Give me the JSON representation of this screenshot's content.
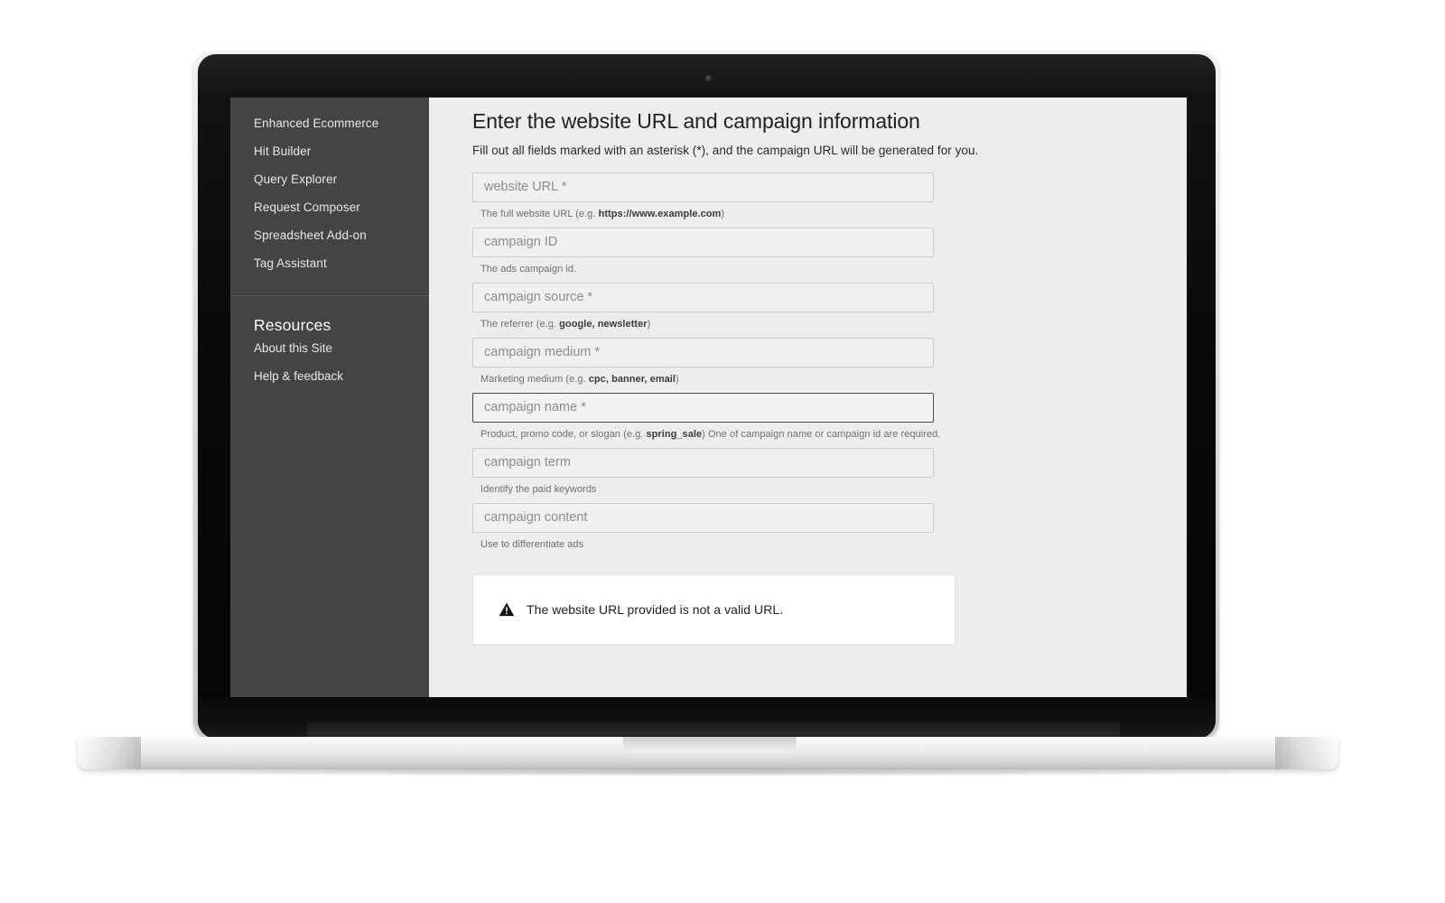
{
  "device": {
    "type": "laptop",
    "webcam_icon": "webcam-dot"
  },
  "sidebar": {
    "nav_items": [
      {
        "label": "Enhanced Ecommerce"
      },
      {
        "label": "Hit Builder"
      },
      {
        "label": "Query Explorer"
      },
      {
        "label": "Request Composer"
      },
      {
        "label": "Spreadsheet Add-on"
      },
      {
        "label": "Tag Assistant"
      }
    ],
    "resources_title": "Resources",
    "resources_items": [
      {
        "label": "About this Site"
      },
      {
        "label": "Help & feedback"
      }
    ],
    "background_color": "#444444",
    "text_color": "#e8e8e8"
  },
  "main": {
    "title": "Enter the website URL and campaign information",
    "subtitle": "Fill out all fields marked with an asterisk (*), and the campaign URL will be generated for you.",
    "background_color": "#ededed",
    "fields": [
      {
        "name": "website-url",
        "placeholder": "website URL *",
        "value": "",
        "help_prefix": "The full website URL (e.g. ",
        "help_bold": "https://www.example.com",
        "help_suffix": ")",
        "focused": false
      },
      {
        "name": "campaign-id",
        "placeholder": "campaign ID",
        "value": "",
        "help_prefix": "The ads campaign id.",
        "help_bold": "",
        "help_suffix": "",
        "focused": false
      },
      {
        "name": "campaign-source",
        "placeholder": "campaign source *",
        "value": "",
        "help_prefix": "The referrer (e.g. ",
        "help_bold": "google, newsletter",
        "help_suffix": ")",
        "focused": false
      },
      {
        "name": "campaign-medium",
        "placeholder": "campaign medium *",
        "value": "",
        "help_prefix": "Marketing medium (e.g. ",
        "help_bold": "cpc, banner, email",
        "help_suffix": ")",
        "focused": false
      },
      {
        "name": "campaign-name",
        "placeholder": "campaign name *",
        "value": "",
        "help_prefix": "Product, promo code, or slogan (e.g. ",
        "help_bold": "spring_sale",
        "help_suffix": ") One of campaign name or campaign id are required.",
        "focused": true
      },
      {
        "name": "campaign-term",
        "placeholder": "campaign term",
        "value": "",
        "help_prefix": "Identify the paid keywords",
        "help_bold": "",
        "help_suffix": "",
        "focused": false
      },
      {
        "name": "campaign-content",
        "placeholder": "campaign content",
        "value": "",
        "help_prefix": "Use to differentiate ads",
        "help_bold": "",
        "help_suffix": "",
        "focused": false
      }
    ],
    "alert": {
      "icon": "warning-triangle-icon",
      "message": "The website URL provided is not a valid URL.",
      "background_color": "#ffffff",
      "icon_color": "#111111"
    }
  }
}
